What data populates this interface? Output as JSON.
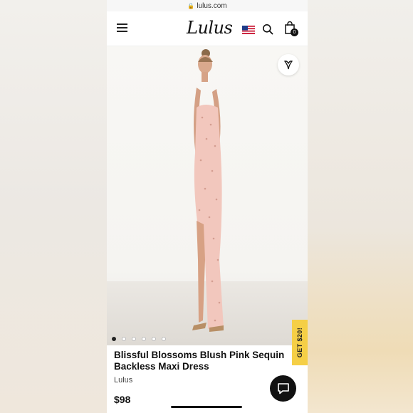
{
  "browser": {
    "url": "lulus.com"
  },
  "header": {
    "logo_text": "Lulus",
    "menu_icon": "hamburger-icon",
    "flag_icon": "us-flag-icon",
    "search_icon": "search-icon",
    "bag_icon": "shopping-bag-icon",
    "bag_count": "0"
  },
  "gallery": {
    "wishlist_icon": "heart-icon",
    "image_count": 6,
    "active_index": 0,
    "promo_label": "GET $20!"
  },
  "product": {
    "title": "Blissful Blossoms Blush Pink Sequin Backless Maxi Dress",
    "brand": "Lulus",
    "price": "$98"
  },
  "chat": {
    "icon": "chat-icon"
  },
  "colors": {
    "promo": "#f5cf46",
    "dress": "#f2c7bd",
    "text": "#111111"
  }
}
